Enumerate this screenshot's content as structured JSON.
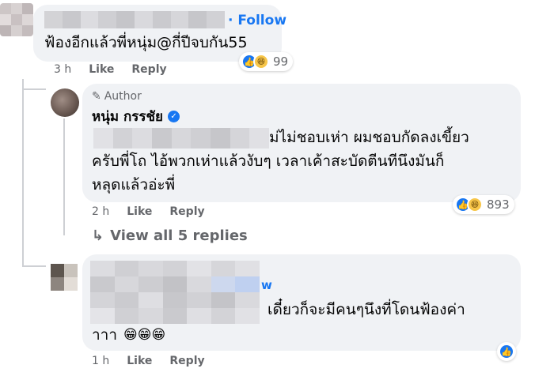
{
  "comment1": {
    "follow_label": "· Follow",
    "text": "ฟ้องอีกแล้วพี่หนุ่ม@กี่ปีจบกัน55",
    "time": "3 h",
    "like_label": "Like",
    "reply_label": "Reply",
    "reaction_count": "99"
  },
  "reply1": {
    "author_badge": "Author",
    "author_name": "หนุ่ม กรรชัย",
    "text_line1": "ม่ไม่ชอบเห่า ผมชอบกัดลงเขี้ยว",
    "text_line2": "ครับพี่โถ ไอ้พวกเห่าแล้วงับๆ เวลาเค้าสะบัดตีนทีนึงมันก็",
    "text_line3": "หลุดแล้วอ่ะพี่",
    "time": "2 h",
    "like_label": "Like",
    "reply_label": "Reply",
    "reaction_count": "893"
  },
  "view_replies": {
    "arrow": "↳",
    "label": "View all 5 replies"
  },
  "comment2": {
    "follow_fragment": "w",
    "text_line1": "เดี๋ยวก็จะมีคนๆนึงที่โดนฟ้องค่า",
    "text_line2": "าาา",
    "emojis": "😁😁😁",
    "time": "1 h",
    "like_label": "Like",
    "reply_label": "Reply"
  },
  "colors": {
    "bubble": "#f0f2f5",
    "link_blue": "#1877f2",
    "meta_gray": "#65676b",
    "text": "#050505"
  }
}
